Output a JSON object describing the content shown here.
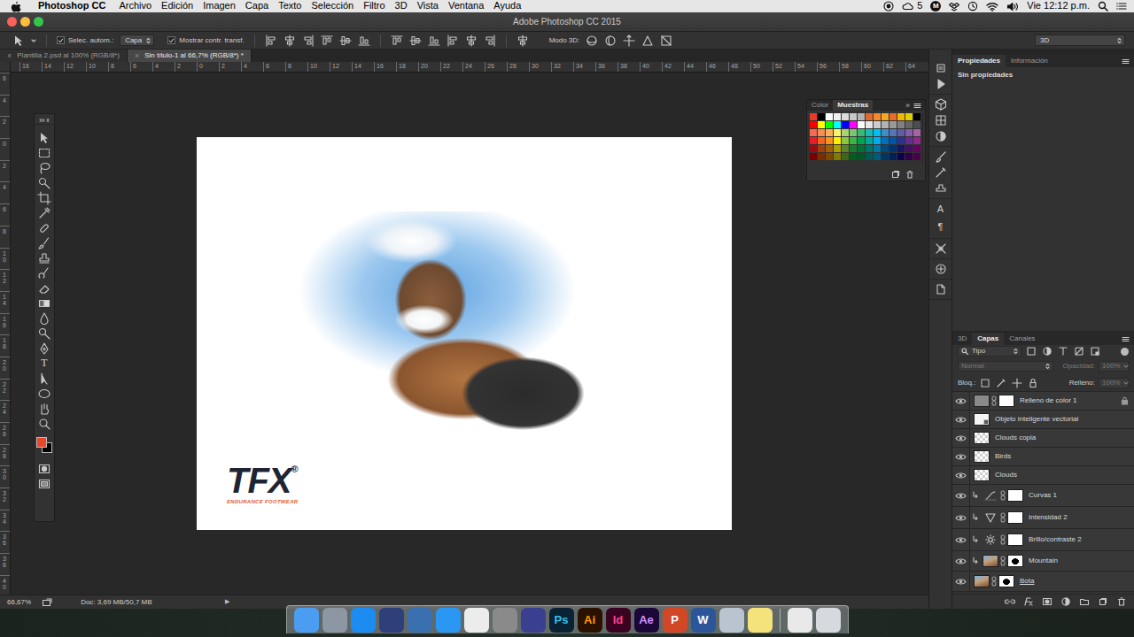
{
  "menubar": {
    "app": "Photoshop CC",
    "items": [
      "Archivo",
      "Edición",
      "Imagen",
      "Capa",
      "Texto",
      "Selección",
      "Filtro",
      "3D",
      "Vista",
      "Ventana",
      "Ayuda"
    ],
    "count": "5",
    "badge": "M",
    "clock": "Vie 12:12 p.m."
  },
  "window": {
    "title": "Adobe Photoshop CC 2015"
  },
  "options_bar": {
    "auto_select": {
      "label": "Selec. autom.:",
      "checked": true
    },
    "auto_select_target": "Capa",
    "show_transform": {
      "label": "Mostrar contr. transf.",
      "checked": true
    },
    "mode_3d": "Modo 3D:",
    "workspace": "3D"
  },
  "doc_tabs": [
    {
      "close": "×",
      "label": "Plantilla 2.psd al 100% (RGB/8*)",
      "selected": false
    },
    {
      "close": "×",
      "label": "Sin título-1 al 66,7% (RGB/8*) *",
      "selected": true
    }
  ],
  "rulers": {
    "horizontal": [
      "16",
      "14",
      "12",
      "10",
      "8",
      "6",
      "4",
      "2",
      "0",
      "2",
      "4",
      "6",
      "8",
      "10",
      "12",
      "14",
      "16",
      "18",
      "20",
      "22",
      "24",
      "26",
      "28",
      "30",
      "32",
      "34",
      "36",
      "38",
      "40",
      "42",
      "44",
      "46",
      "48",
      "50",
      "52",
      "54",
      "56",
      "58",
      "60",
      "62",
      "64"
    ],
    "vertical": [
      "6",
      "4",
      "2",
      "0",
      "2",
      "4",
      "6",
      "8",
      "10",
      "12",
      "14",
      "16",
      "18",
      "20",
      "22",
      "24",
      "26",
      "28",
      "30",
      "32",
      "34",
      "36",
      "38",
      "40"
    ]
  },
  "tools": {
    "text_glyph": "T",
    "foreground": "#e8452c",
    "background": "#000000"
  },
  "document": {
    "logo": {
      "mark": "TFX",
      "reg": "®",
      "tagline": "ENDURANCE FOOTWEAR"
    }
  },
  "color_panel": {
    "tabs": [
      {
        "label": "Color",
        "selected": false
      },
      {
        "label": "Muestras",
        "selected": true
      }
    ],
    "collapse": "»",
    "swatches": [
      {
        "color": "#e8392a"
      },
      {
        "color": "#000000"
      },
      {
        "color": "#ffffff"
      },
      {
        "color": "#f0f0f0"
      },
      {
        "color": "#dcdcdc"
      },
      {
        "color": "#c8c8c8"
      },
      {
        "color": "#b4b4b4"
      },
      {
        "color": "#e06a2c"
      },
      {
        "color": "#f08a2c"
      },
      {
        "color": "#f5a623"
      },
      {
        "color": "#e86c2c"
      },
      {
        "color": "#f4b800"
      },
      {
        "color": "#e0d000"
      },
      {
        "color": "#000000"
      },
      {
        "color": "#ff0000"
      },
      {
        "color": "#ffff00"
      },
      {
        "color": "#00ff00"
      },
      {
        "color": "#00ffff"
      },
      {
        "color": "#0000ff"
      },
      {
        "color": "#ff00ff"
      },
      {
        "color": "#ffffff"
      },
      {
        "color": "#e6e6e6"
      },
      {
        "color": "#cccccc"
      },
      {
        "color": "#b3b3b3"
      },
      {
        "color": "#999999"
      },
      {
        "color": "#808080"
      },
      {
        "color": "#666666"
      },
      {
        "color": "#4d4d4d"
      },
      {
        "color": "#f26c4f"
      },
      {
        "color": "#f68e55"
      },
      {
        "color": "#fbaf5c"
      },
      {
        "color": "#fff467"
      },
      {
        "color": "#acd372"
      },
      {
        "color": "#7cc576"
      },
      {
        "color": "#3bb878"
      },
      {
        "color": "#1abbb4"
      },
      {
        "color": "#00bff3"
      },
      {
        "color": "#438ccb"
      },
      {
        "color": "#5574b9"
      },
      {
        "color": "#605ca8"
      },
      {
        "color": "#855fa8"
      },
      {
        "color": "#a763a8"
      },
      {
        "color": "#ed1c24"
      },
      {
        "color": "#f26522"
      },
      {
        "color": "#f7941d"
      },
      {
        "color": "#fff200"
      },
      {
        "color": "#8dc63f"
      },
      {
        "color": "#39b54a"
      },
      {
        "color": "#00a651"
      },
      {
        "color": "#00a99d"
      },
      {
        "color": "#00aeef"
      },
      {
        "color": "#0072bc"
      },
      {
        "color": "#0054a6"
      },
      {
        "color": "#2e3192"
      },
      {
        "color": "#662d91"
      },
      {
        "color": "#92278f"
      },
      {
        "color": "#9e0b0f"
      },
      {
        "color": "#a0410d"
      },
      {
        "color": "#a36209"
      },
      {
        "color": "#aba000"
      },
      {
        "color": "#598527"
      },
      {
        "color": "#1a7b30"
      },
      {
        "color": "#007236"
      },
      {
        "color": "#00746b"
      },
      {
        "color": "#0076a3"
      },
      {
        "color": "#004b80"
      },
      {
        "color": "#003471"
      },
      {
        "color": "#1b1464"
      },
      {
        "color": "#440e62"
      },
      {
        "color": "#630460"
      },
      {
        "color": "#790000"
      },
      {
        "color": "#7b2e00"
      },
      {
        "color": "#7d4900"
      },
      {
        "color": "#827b00"
      },
      {
        "color": "#406618"
      },
      {
        "color": "#005e20"
      },
      {
        "color": "#005826"
      },
      {
        "color": "#005952"
      },
      {
        "color": "#005b7f"
      },
      {
        "color": "#003663"
      },
      {
        "color": "#002157"
      },
      {
        "color": "#0d004c"
      },
      {
        "color": "#32004b"
      },
      {
        "color": "#4b0049"
      }
    ]
  },
  "icon_strip": {
    "glyphs": [
      "A",
      "¶"
    ]
  },
  "properties": {
    "tabs": [
      {
        "label": "Propiedades",
        "selected": true
      },
      {
        "label": "Información",
        "selected": false
      }
    ],
    "content": "Sin propiedades"
  },
  "layers_panel": {
    "tabs": [
      {
        "label": "3D",
        "selected": false
      },
      {
        "label": "Capas",
        "selected": true
      },
      {
        "label": "Canales",
        "selected": false
      }
    ],
    "filter": {
      "label": "Tipo"
    },
    "blend_mode": {
      "label": "Normal",
      "disabled": true
    },
    "opacity": {
      "label": "Opacidad:",
      "value": "100%",
      "disabled": true
    },
    "lock": {
      "label": "Bloq.:"
    },
    "fill": {
      "label": "Relleno:",
      "value": "100%",
      "disabled": true
    },
    "layers": [
      {
        "name": "Relleno de color 1",
        "visible": true,
        "kind": "fill",
        "clipped": false,
        "mask": true,
        "locked": true,
        "selected": false,
        "clip_base": false
      },
      {
        "name": "Objeto inteligente vectorial",
        "visible": true,
        "kind": "smart",
        "clipped": false,
        "mask": false,
        "locked": false,
        "selected": false,
        "clip_base": false
      },
      {
        "name": "Clouds copia",
        "visible": true,
        "kind": "pixel",
        "clipped": false,
        "mask": false,
        "locked": false,
        "selected": false,
        "clip_base": false
      },
      {
        "name": "Birds",
        "visible": true,
        "kind": "pixel",
        "clipped": false,
        "mask": false,
        "locked": false,
        "selected": false,
        "clip_base": false
      },
      {
        "name": "Clouds",
        "visible": true,
        "kind": "pixel",
        "clipped": false,
        "mask": false,
        "locked": false,
        "selected": false,
        "clip_base": false
      },
      {
        "name": "Curvas 1",
        "visible": true,
        "kind": "curves",
        "clipped": true,
        "mask": true,
        "locked": false,
        "selected": false,
        "clip_base": false
      },
      {
        "name": "Intensidad 2",
        "visible": true,
        "kind": "vibrance",
        "clipped": true,
        "mask": true,
        "locked": false,
        "selected": false,
        "clip_base": false
      },
      {
        "name": "Brillo/contraste 2",
        "visible": true,
        "kind": "brightness",
        "clipped": true,
        "mask": true,
        "locked": false,
        "selected": false,
        "clip_base": false
      },
      {
        "name": "Mountain",
        "visible": true,
        "kind": "photo",
        "clipped": true,
        "mask": true,
        "locked": false,
        "selected": false,
        "clip_base": false
      },
      {
        "name": "Bota",
        "visible": true,
        "kind": "photo",
        "clipped": false,
        "mask": true,
        "locked": false,
        "selected": false,
        "clip_base": true
      }
    ]
  },
  "status_bar": {
    "zoom": "66,67%",
    "doc": "Doc: 3,69 MB/50,7 MB",
    "arrow": "▶"
  },
  "dock": [
    {
      "kind": "plain",
      "color": "#4a9df0"
    },
    {
      "kind": "plain",
      "color": "#8d96a3"
    },
    {
      "kind": "plain",
      "color": "#1c8cf0"
    },
    {
      "kind": "plain",
      "color": "#2e3f7a"
    },
    {
      "kind": "plain",
      "color": "#3a6fb0"
    },
    {
      "kind": "plain",
      "color": "#2a97f2"
    },
    {
      "kind": "plain",
      "color": "#ececec"
    },
    {
      "kind": "plain",
      "color": "#8a8a8a"
    },
    {
      "kind": "plain",
      "color": "#3b3f8f"
    },
    {
      "kind": "letter",
      "label": "Ps",
      "color": "#0a2233",
      "text_color": "#31c5f0"
    },
    {
      "kind": "letter",
      "label": "Ai",
      "color": "#2b1200",
      "text_color": "#ff9a00"
    },
    {
      "kind": "letter",
      "label": "Id",
      "color": "#3a0320",
      "text_color": "#ff3f94"
    },
    {
      "kind": "letter",
      "label": "Ae",
      "color": "#1c0838",
      "text_color": "#d291ff"
    },
    {
      "kind": "letter",
      "label": "P",
      "color": "#d24726",
      "text_color": "#ffffff"
    },
    {
      "kind": "letter",
      "label": "W",
      "color": "#2b579a",
      "text_color": "#ffffff"
    },
    {
      "kind": "plain",
      "color": "#b9c4d0"
    },
    {
      "kind": "plain",
      "color": "#f4e27a"
    },
    {
      "kind": "separator"
    },
    {
      "kind": "plain",
      "color": "#e9e9e9"
    },
    {
      "kind": "plain",
      "color": "#d6dade"
    }
  ]
}
